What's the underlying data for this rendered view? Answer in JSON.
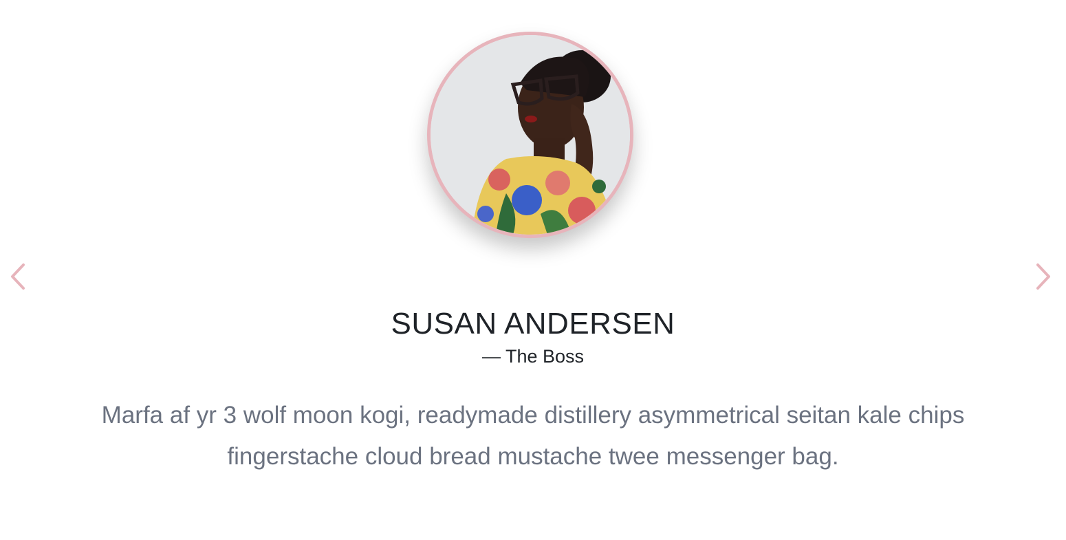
{
  "testimonial": {
    "name": "SUSAN ANDERSEN",
    "role": "— The Boss",
    "quote": "Marfa af yr 3 wolf moon kogi, readymade distillery asymmetrical seitan kale chips fingerstache cloud bread mustache twee messenger bag."
  },
  "navigation": {
    "prev_icon": "chevron-left-icon",
    "next_icon": "chevron-right-icon"
  },
  "colors": {
    "accent": "#e7b4bb",
    "name_text": "#1f2328",
    "quote_text": "#6b7280",
    "background": "#ffffff"
  }
}
